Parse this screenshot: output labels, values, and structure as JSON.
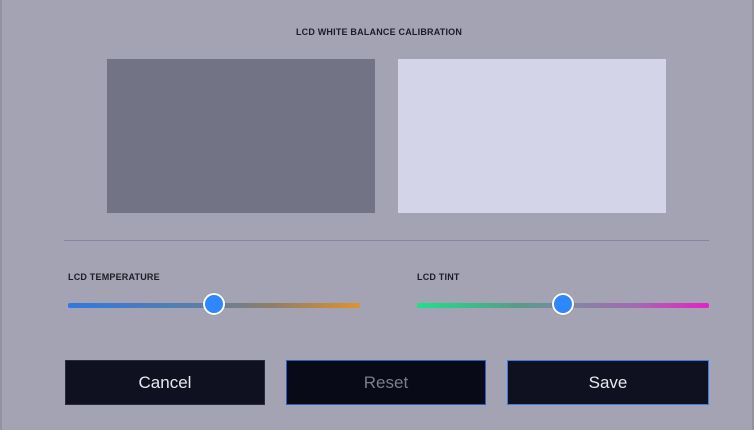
{
  "title": "LCD WHITE BALANCE CALIBRATION",
  "swatches": {
    "dark_color": "#737386",
    "light_color": "#d4d4e8"
  },
  "sliders": {
    "temperature": {
      "label": "LCD TEMPERATURE",
      "value_fraction": 0.5,
      "gradient": [
        "#2f79e0",
        "#e0922c"
      ]
    },
    "tint": {
      "label": "LCD TINT",
      "value_fraction": 0.5,
      "gradient": [
        "#1fe08a",
        "#e620c8"
      ]
    },
    "thumb_color": "#2f87ff"
  },
  "buttons": {
    "cancel": "Cancel",
    "reset": "Reset",
    "save": "Save"
  },
  "colors": {
    "background": "#a3a3b4",
    "accent": "#3b7de8"
  }
}
